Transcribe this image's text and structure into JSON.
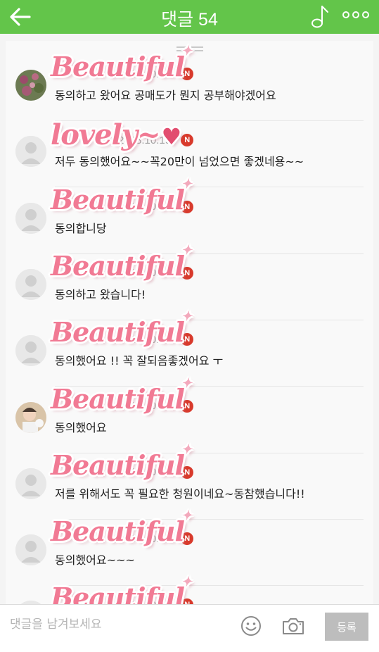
{
  "header": {
    "title": "댓글 54",
    "color": "#63c54a"
  },
  "comments": [
    {
      "date": "2018.10.19.",
      "badge": "N",
      "text": "동의하고 왔어요 공매도가 뭔지 공부해야겠어요",
      "avatar": "photo-flowers",
      "sticker": "Beautiful"
    },
    {
      "date": "2018.10.19.",
      "badge": "N",
      "text": "저두 동의했어요~~꼭20만이 넘었으면 좋겠네용~~",
      "avatar": "default-person",
      "sticker": "lovely~"
    },
    {
      "date": "2018.10.19.",
      "badge": "N",
      "text": "동의합니당",
      "avatar": "default-person",
      "sticker": "Beautiful"
    },
    {
      "date": "2018.10.19.",
      "badge": "N",
      "text": "동의하고 왔습니다!",
      "avatar": "default-person",
      "sticker": "Beautiful"
    },
    {
      "date": "2018.10.19.",
      "badge": "N",
      "text": "동의했어요 !! 꼭 잘되음좋겠어요 ㅜ",
      "avatar": "default-person",
      "sticker": "Beautiful"
    },
    {
      "date": "2018.10.19.",
      "badge": "N",
      "text": "동의했어요",
      "avatar": "photo-child",
      "sticker": "Beautiful"
    },
    {
      "date": "2018.10.19.",
      "badge": "N",
      "text": "저를 위해서도 꼭 필요한 청원이네요~동참했습니다!!",
      "avatar": "default-person",
      "sticker": "Beautiful"
    },
    {
      "date": "2018.10.19.",
      "badge": "N",
      "text": "동의했어요~~~",
      "avatar": "default-person",
      "sticker": "Beautiful"
    },
    {
      "date": "2018.10.19.",
      "badge": "N",
      "text": "",
      "avatar": "default-person",
      "sticker": "Beautiful"
    }
  ],
  "input": {
    "placeholder": "댓글을 남겨보세요",
    "submit_label": "등록"
  },
  "icons": [
    "back-arrow-icon",
    "music-note-icon",
    "more-dots-icon",
    "emoji-icon",
    "camera-icon"
  ],
  "colors": {
    "badge": "#d83a2c",
    "sticker_pink": "#f17a94"
  }
}
